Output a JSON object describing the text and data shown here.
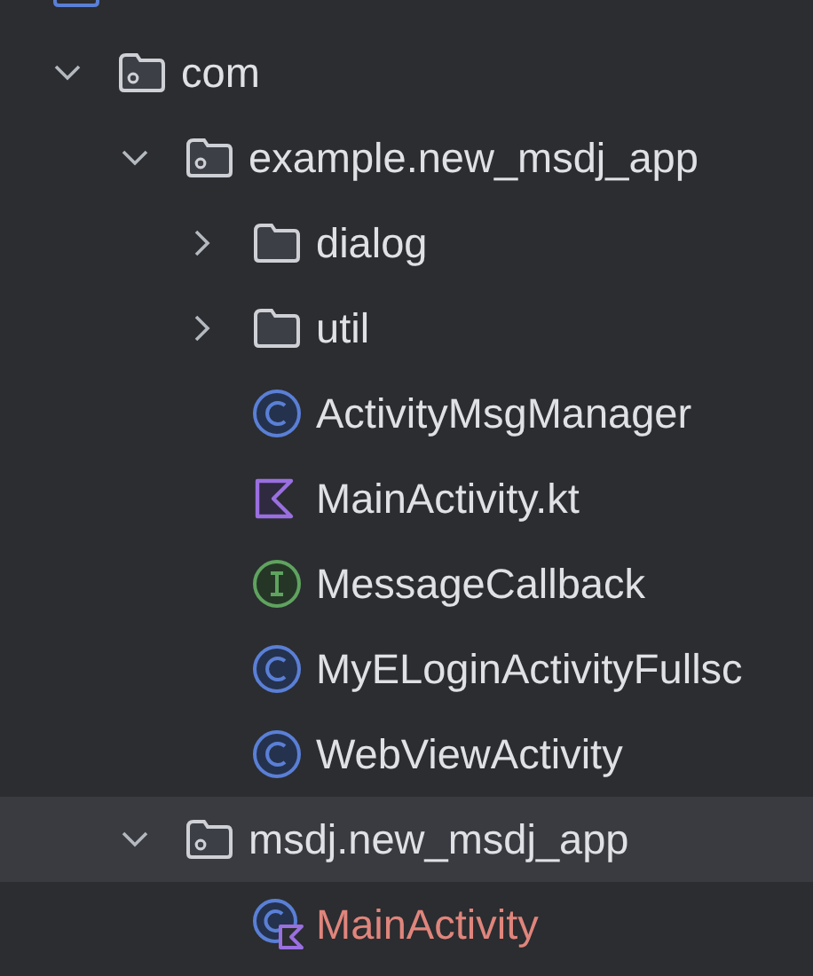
{
  "tree": [
    {
      "name": "com",
      "kind": "package",
      "expanded": true,
      "selected": false,
      "color": "#dfe1e5",
      "children": [
        {
          "name": "example.new_msdj_app",
          "kind": "package",
          "expanded": true,
          "selected": false,
          "color": "#dfe1e5",
          "children": [
            {
              "name": "dialog",
              "kind": "folder",
              "expanded": false,
              "selected": false,
              "color": "#dfe1e5"
            },
            {
              "name": "util",
              "kind": "folder",
              "expanded": false,
              "selected": false,
              "color": "#dfe1e5"
            },
            {
              "name": "ActivityMsgManager",
              "kind": "class",
              "selected": false,
              "color": "#dfe1e5"
            },
            {
              "name": "MainActivity.kt",
              "kind": "kotlin-file",
              "selected": false,
              "color": "#dfe1e5"
            },
            {
              "name": "MessageCallback",
              "kind": "interface",
              "selected": false,
              "color": "#dfe1e5"
            },
            {
              "name": "MyELoginActivityFullsc",
              "kind": "class",
              "selected": false,
              "color": "#dfe1e5"
            },
            {
              "name": "WebViewActivity",
              "kind": "class",
              "selected": false,
              "color": "#dfe1e5"
            }
          ]
        },
        {
          "name": "msdj.new_msdj_app",
          "kind": "package",
          "expanded": true,
          "selected": true,
          "color": "#dfe1e5",
          "children": [
            {
              "name": "MainActivity",
              "kind": "kotlin-class",
              "selected": false,
              "color": "#e0857c"
            }
          ]
        }
      ]
    }
  ]
}
